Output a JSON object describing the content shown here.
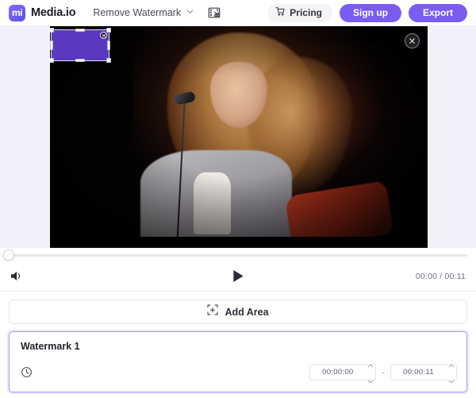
{
  "header": {
    "logo_text": "Media.io",
    "logo_mark": "mi",
    "logo_icon_name": "media-io-logo-icon",
    "tool_label": "Remove Watermark",
    "chevron_icon": "chevron-down-icon",
    "cut_icon": "video-cut-icon",
    "pricing_label": "Pricing",
    "pricing_icon": "cart-icon",
    "signup_label": "Sign up",
    "export_label": "Export",
    "accent_color": "#7a5cf0",
    "pricing_bg": "#f4f4f7"
  },
  "stage": {
    "close_icon": "close-icon",
    "selection": {
      "name": "watermark-selection-region",
      "fill_color": "#5b38c0",
      "delete_icon": "delete-selection-icon"
    },
    "video_bg": "#000000",
    "stage_bg": "#f2f1f9"
  },
  "player": {
    "volume_icon": "volume-icon",
    "play_icon": "play-icon",
    "current_time": "00:00",
    "total_time": "00:11",
    "time_display": "00:00 / 00:11",
    "progress_percent": 0
  },
  "add_area": {
    "label": "Add Area",
    "icon": "add-area-icon"
  },
  "watermark_panel": {
    "title": "Watermark 1",
    "clock_icon": "clock-icon",
    "start_time": "00:00:00",
    "end_time": "00:00:11",
    "separator": "-",
    "border_color": "#a99df0",
    "stepper_up_icon": "chevron-up-icon",
    "stepper_down_icon": "chevron-down-icon"
  }
}
